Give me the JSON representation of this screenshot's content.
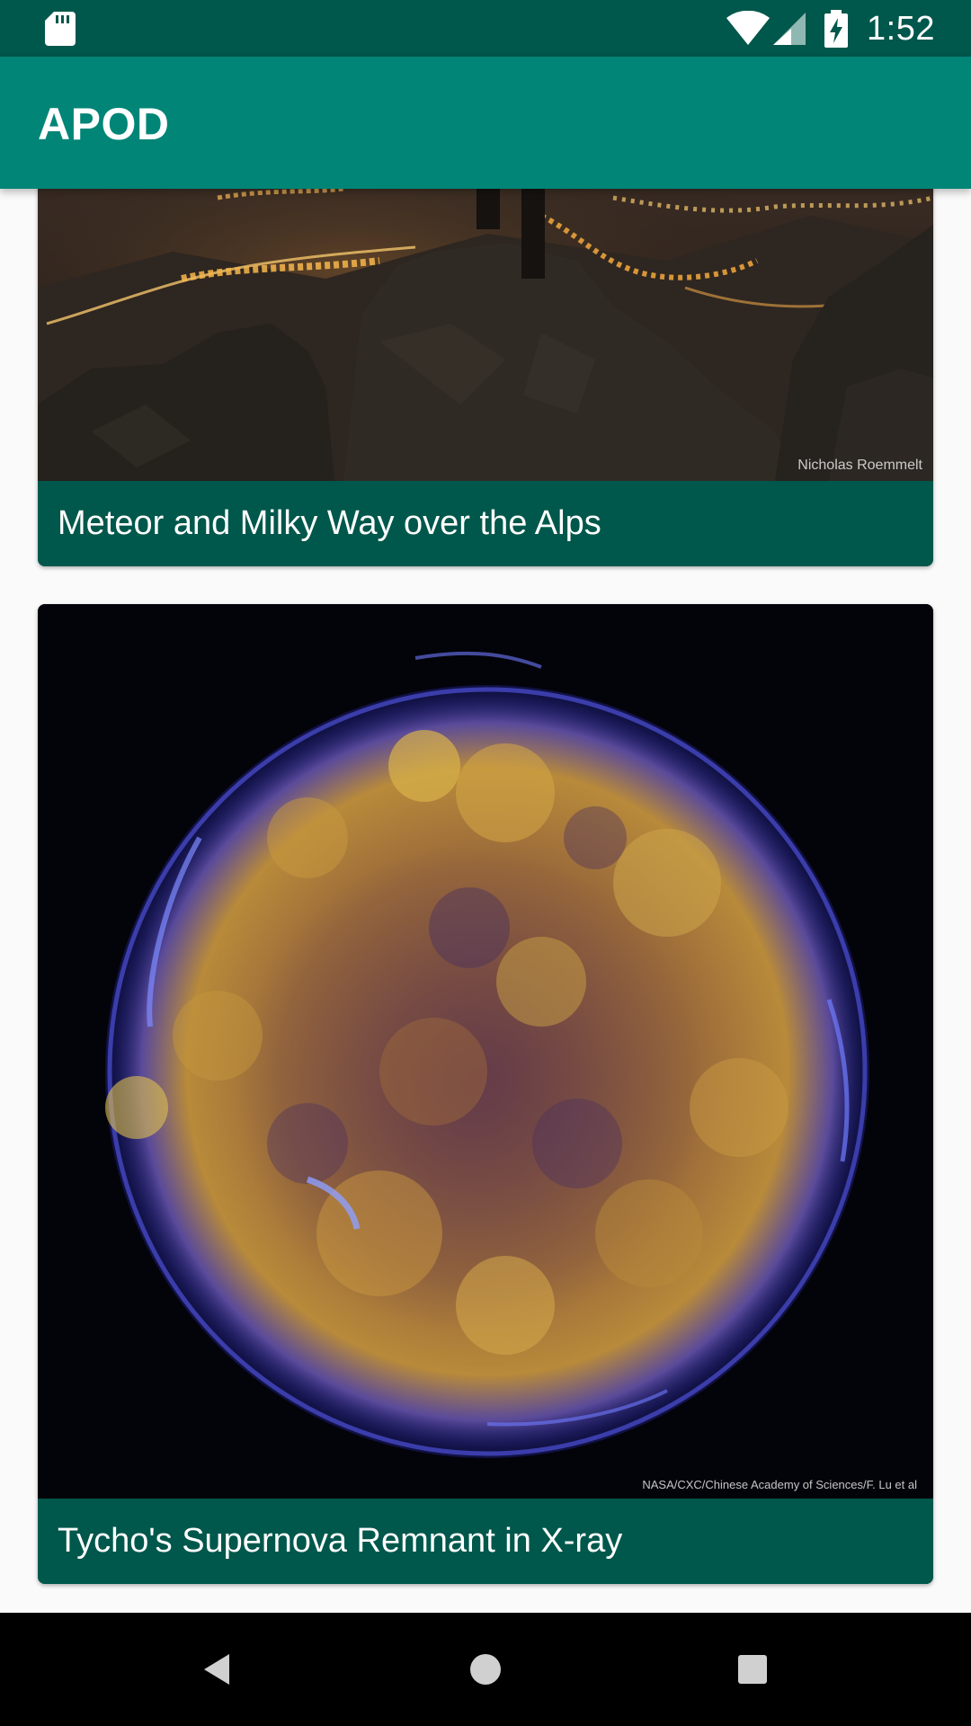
{
  "status_bar": {
    "time": "1:52",
    "icons": [
      "sd-card-icon",
      "wifi-icon",
      "signal-icon",
      "battery-charging-icon"
    ]
  },
  "app_bar": {
    "title": "APOD"
  },
  "cards": [
    {
      "title": "Meteor and Milky Way over the Alps",
      "credit": "Nicholas Roemmelt"
    },
    {
      "title": "Tycho's Supernova Remnant in X-ray",
      "credit": "NASA/CXC/Chinese Academy of Sciences/F. Lu et al"
    }
  ],
  "nav_bar": {
    "icons": [
      "back-icon",
      "home-icon",
      "recents-icon"
    ]
  },
  "colors": {
    "status_bar": "#00574b",
    "app_bar": "#008577",
    "caption_bg": "#00574b",
    "background": "#fafafa"
  }
}
